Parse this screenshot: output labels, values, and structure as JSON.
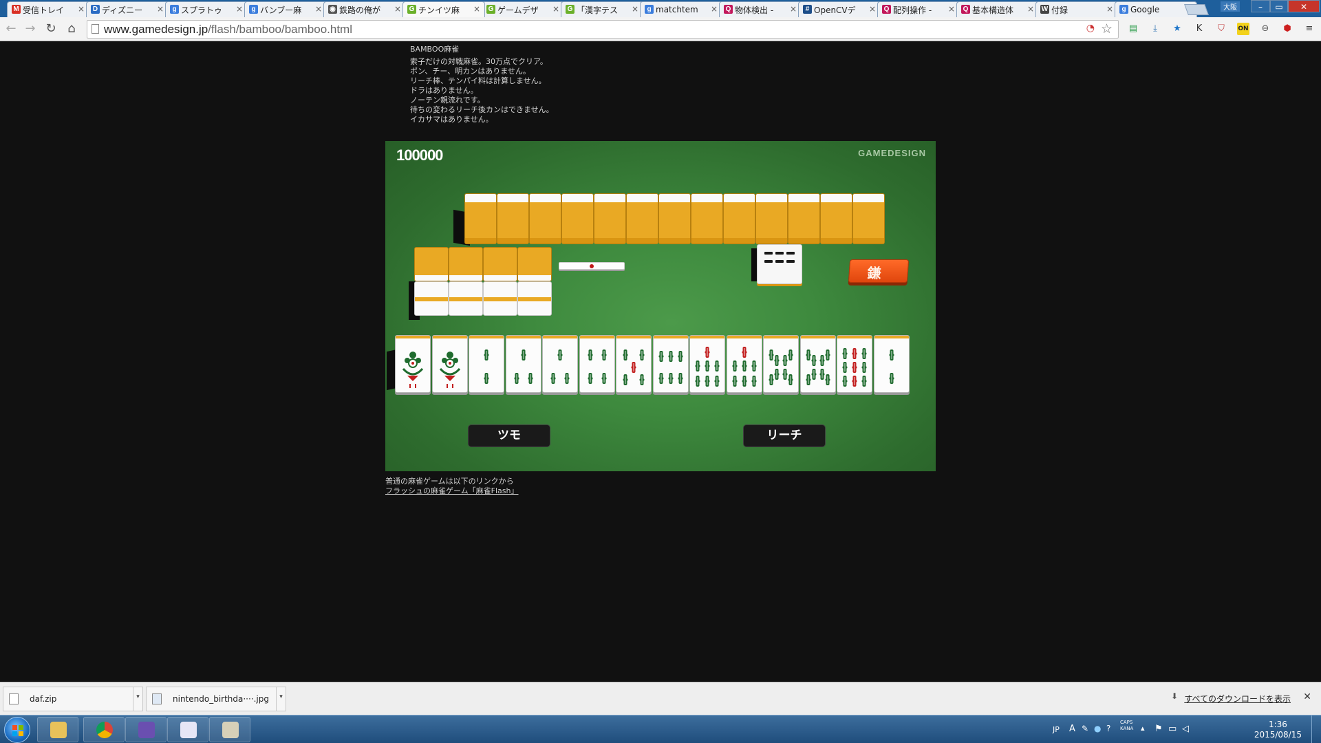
{
  "browser": {
    "tabs": [
      {
        "label": "受信トレイ",
        "favicon": "gmail-icon",
        "color": "#d93025",
        "letter": "M"
      },
      {
        "label": "ディズニー",
        "favicon": "site-icon",
        "color": "#2b6cc4",
        "letter": "D"
      },
      {
        "label": "スプラトゥ",
        "favicon": "google-icon",
        "color": "#3b7ddd",
        "letter": "g"
      },
      {
        "label": "バンブー麻",
        "favicon": "google-icon",
        "color": "#3b7ddd",
        "letter": "g"
      },
      {
        "label": "鉄路の俺が",
        "favicon": "site-icon",
        "color": "#555555",
        "letter": "◉"
      },
      {
        "label": "チンイツ麻",
        "favicon": "gamedesign-icon",
        "color": "#6bb02a",
        "letter": "G",
        "active": true
      },
      {
        "label": "ゲームデザ",
        "favicon": "gamedesign-icon",
        "color": "#6bb02a",
        "letter": "G"
      },
      {
        "label": "「漢字テス",
        "favicon": "gamedesign-icon",
        "color": "#6bb02a",
        "letter": "G"
      },
      {
        "label": "matchtem",
        "favicon": "google-icon",
        "color": "#3b7ddd",
        "letter": "g"
      },
      {
        "label": "物体検出 -",
        "favicon": "qiita-icon",
        "color": "#c2185b",
        "letter": "Q"
      },
      {
        "label": "OpenCVデ",
        "favicon": "grid-icon",
        "color": "#1d4e89",
        "letter": "#"
      },
      {
        "label": "配列操作 -",
        "favicon": "qiita-icon",
        "color": "#c2185b",
        "letter": "Q"
      },
      {
        "label": "基本構造体",
        "favicon": "qiita-icon",
        "color": "#c2185b",
        "letter": "Q"
      },
      {
        "label": "付録",
        "favicon": "wiki-icon",
        "color": "#444444",
        "letter": "W"
      },
      {
        "label": "Google",
        "favicon": "google-icon",
        "color": "#3b7ddd",
        "letter": "g"
      }
    ],
    "user_label": "大阪",
    "url_host": "www.gamedesign.jp",
    "url_path": "/flash/bamboo/bamboo.html",
    "extensions": [
      {
        "name": "translate-extension-icon",
        "glyph": "▤",
        "color": "#2e9d4c"
      },
      {
        "name": "download-extension-icon",
        "glyph": "⤓",
        "color": "#2a6fb0"
      },
      {
        "name": "bookmark-extension-icon",
        "glyph": "★",
        "color": "#1b73c8"
      },
      {
        "name": "k-extension-icon",
        "glyph": "K",
        "color": "#333333"
      },
      {
        "name": "shield-extension-icon",
        "glyph": "⛉",
        "color": "#c23b3b"
      },
      {
        "name": "on-extension-icon",
        "glyph": "ON",
        "color": "#e0b400"
      },
      {
        "name": "minus-extension-icon",
        "glyph": "⊖",
        "color": "#555555"
      },
      {
        "name": "adblock-extension-icon",
        "glyph": "⬢",
        "color": "#cc1f1f"
      },
      {
        "name": "menu-icon",
        "glyph": "≡",
        "color": "#444444"
      }
    ]
  },
  "page": {
    "title": "BAMBOO麻雀",
    "description_lines": [
      "索子だけの対戦麻雀。30万点でクリア。",
      "ポン、チー、明カンはありません。",
      "リーチ棒、テンパイ料は計算しません。",
      "ドラはありません。",
      "ノーテン親流れです。",
      "待ちの変わるリーチ後カンはできません。",
      "イカサマはありません。"
    ],
    "footer_text": "普通の麻雀ゲームは以下のリンクから",
    "footer_link": "フラッシュの麻雀ゲーム「麻雀Flash」"
  },
  "game": {
    "score": "100000",
    "brand": "GAMEDESIGN",
    "opponent_tile_count": 13,
    "discard_glyph": "鎌",
    "hand_tiles": [
      "1s",
      "1s",
      "2s",
      "3s",
      "3s",
      "4s",
      "5s",
      "6s",
      "7s",
      "7s",
      "8s",
      "8s",
      "9s",
      "2s"
    ],
    "buttons": {
      "tsumo": "ツモ",
      "riichi": "リーチ"
    }
  },
  "downloads": {
    "items": [
      {
        "name": "daf.zip"
      },
      {
        "name": "nintendo_birthda····.jpg"
      }
    ],
    "show_all": "すべてのダウンロードを表示"
  },
  "taskbar": {
    "apps": [
      {
        "name": "explorer-icon",
        "color": "#e8c25a"
      },
      {
        "name": "chrome-icon",
        "color": "#d94434"
      },
      {
        "name": "visual-studio-icon",
        "color": "#6a4fb0"
      },
      {
        "name": "notepad-icon",
        "color": "#e6e6f6"
      },
      {
        "name": "paint-icon",
        "color": "#d6d0b8"
      }
    ],
    "lang": "JP",
    "caps": "CAPS",
    "kana": "KANA",
    "time": "1:36",
    "date": "2015/08/15"
  }
}
